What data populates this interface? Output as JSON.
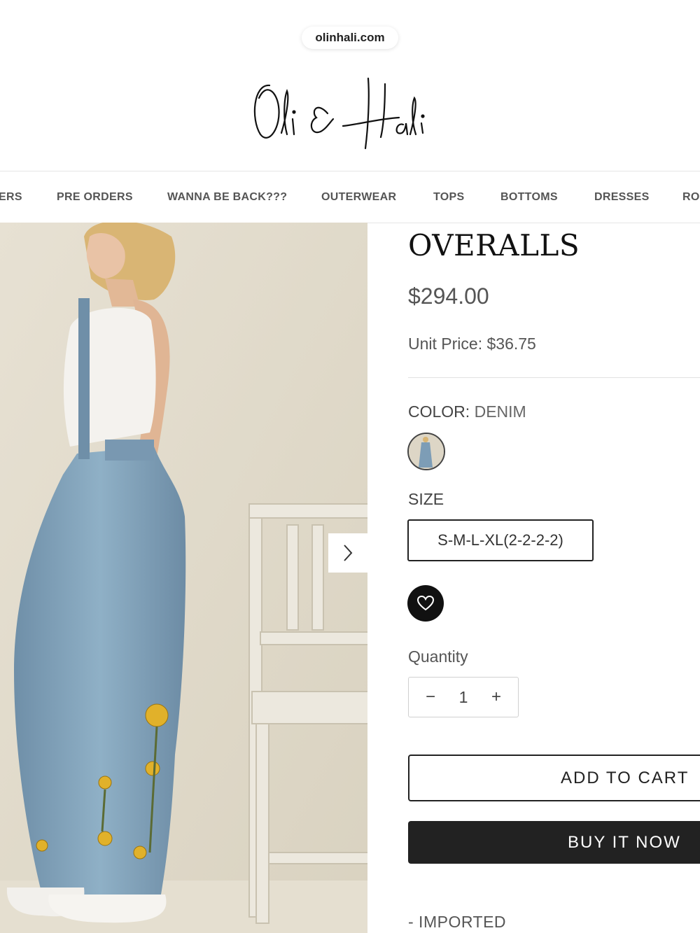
{
  "browser": {
    "url": "olinhali.com"
  },
  "store": {
    "logo_text": "Oli & Hali"
  },
  "nav": {
    "items": [
      "ERS",
      "PRE ORDERS",
      "WANNA BE BACK???",
      "OUTERWEAR",
      "TOPS",
      "BOTTOMS",
      "DRESSES",
      "RO"
    ]
  },
  "gallery": {
    "next_icon": "chevron-right-icon"
  },
  "product": {
    "title": "OVERALLS",
    "price": "$294.00",
    "unit_price_label": "Unit Price:",
    "unit_price": "$36.75",
    "color_label": "COLOR:",
    "color_value": "DENIM",
    "size_label": "SIZE",
    "size_option": "S-M-L-XL(2-2-2-2)",
    "wishlist_icon": "heart-icon",
    "quantity_label": "Quantity",
    "quantity_value": "1",
    "quantity_minus": "−",
    "quantity_plus": "+",
    "add_to_cart": "ADD TO CART",
    "buy_now": "BUY IT NOW",
    "description_line": "- IMPORTED"
  },
  "colors": {
    "accent": "#222222",
    "text_muted": "#555555",
    "border": "#e2e2e2"
  }
}
